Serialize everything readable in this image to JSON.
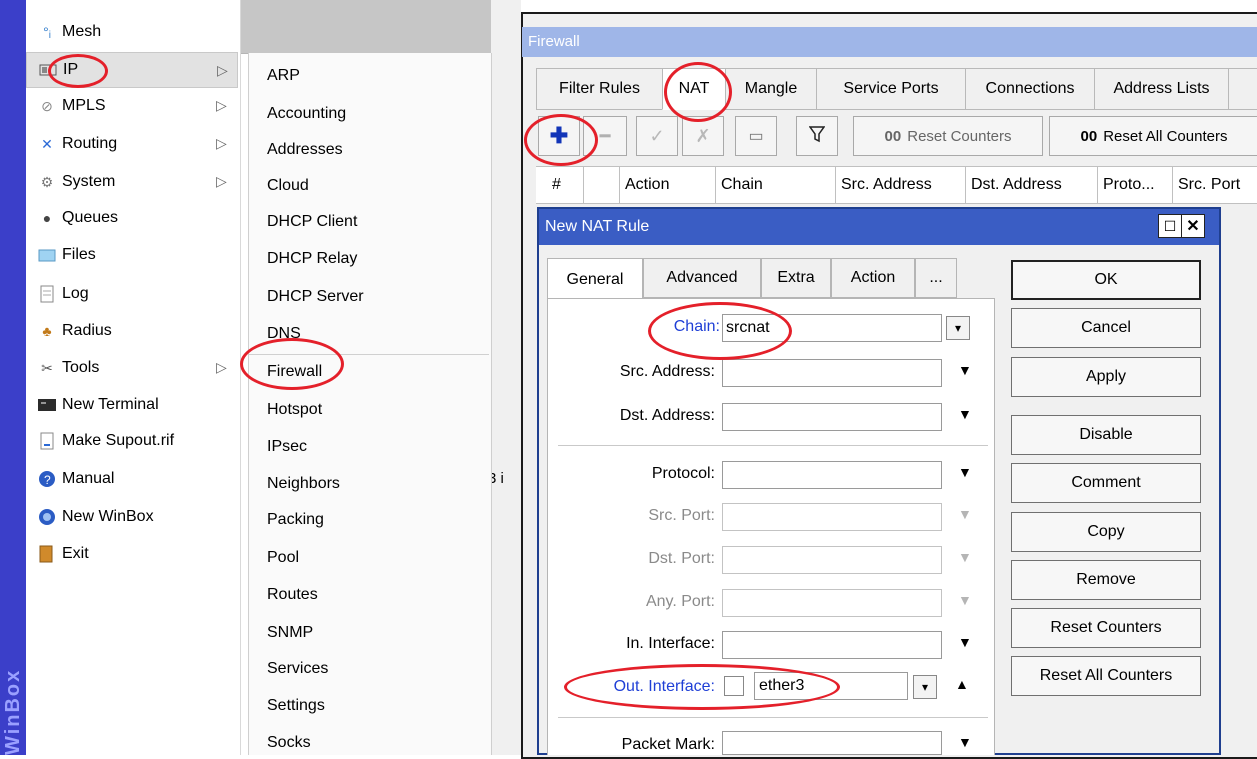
{
  "brand_vertical": "WinBox",
  "left_menu": [
    {
      "label": "Mesh",
      "icon": "mesh-icon",
      "arrow": false
    },
    {
      "label": "IP",
      "icon": "ip-icon",
      "arrow": true
    },
    {
      "label": "MPLS",
      "icon": "mpls-icon",
      "arrow": true
    },
    {
      "label": "Routing",
      "icon": "routing-icon",
      "arrow": true
    },
    {
      "label": "System",
      "icon": "system-gear-icon",
      "arrow": true
    },
    {
      "label": "Queues",
      "icon": "queues-icon",
      "arrow": false
    },
    {
      "label": "Files",
      "icon": "folder-icon",
      "arrow": false
    },
    {
      "label": "Log",
      "icon": "log-icon",
      "arrow": false
    },
    {
      "label": "Radius",
      "icon": "radius-icon",
      "arrow": false
    },
    {
      "label": "Tools",
      "icon": "tools-icon",
      "arrow": true
    },
    {
      "label": "New Terminal",
      "icon": "terminal-icon",
      "arrow": false
    },
    {
      "label": "Make Supout.rif",
      "icon": "supout-icon",
      "arrow": false
    },
    {
      "label": "Manual",
      "icon": "help-icon",
      "arrow": false
    },
    {
      "label": "New WinBox",
      "icon": "winbox-icon",
      "arrow": false
    },
    {
      "label": "Exit",
      "icon": "exit-icon",
      "arrow": false
    }
  ],
  "ip_submenu": [
    "ARP",
    "Accounting",
    "Addresses",
    "Cloud",
    "DHCP Client",
    "DHCP Relay",
    "DHCP Server",
    "DNS",
    "Firewall",
    "Hotspot",
    "IPsec",
    "Neighbors",
    "Packing",
    "Pool",
    "Routes",
    "SNMP",
    "Services",
    "Settings",
    "Socks"
  ],
  "stray_text": "3 i",
  "firewall": {
    "title": "Firewall",
    "tabs": [
      "Filter Rules",
      "NAT",
      "Mangle",
      "Service Ports",
      "Connections",
      "Address Lists"
    ],
    "toolbar": {
      "reset_counters": "Reset Counters",
      "reset_all_counters": "Reset All Counters",
      "counter_prefix": "00"
    },
    "columns": [
      "#",
      "Action",
      "Chain",
      "Src. Address",
      "Dst. Address",
      "Proto...",
      "Src. Port"
    ]
  },
  "nat_rule": {
    "title": "New NAT Rule",
    "tabs": [
      "General",
      "Advanced",
      "Extra",
      "Action",
      "..."
    ],
    "fields": {
      "chain_label": "Chain:",
      "chain_value": "srcnat",
      "src_address": "Src. Address:",
      "dst_address": "Dst. Address:",
      "protocol": "Protocol:",
      "src_port": "Src. Port:",
      "dst_port": "Dst. Port:",
      "any_port": "Any. Port:",
      "in_interface": "In. Interface:",
      "out_interface_label": "Out. Interface:",
      "out_interface_value": "ether3",
      "packet_mark": "Packet Mark:"
    },
    "buttons": [
      "OK",
      "Cancel",
      "Apply",
      "Disable",
      "Comment",
      "Copy",
      "Remove",
      "Reset Counters",
      "Reset All Counters"
    ]
  },
  "colors": {
    "accent_blue": "#3a5dc4",
    "link_blue": "#1f3fd6",
    "annotation_red": "#e4202a"
  }
}
